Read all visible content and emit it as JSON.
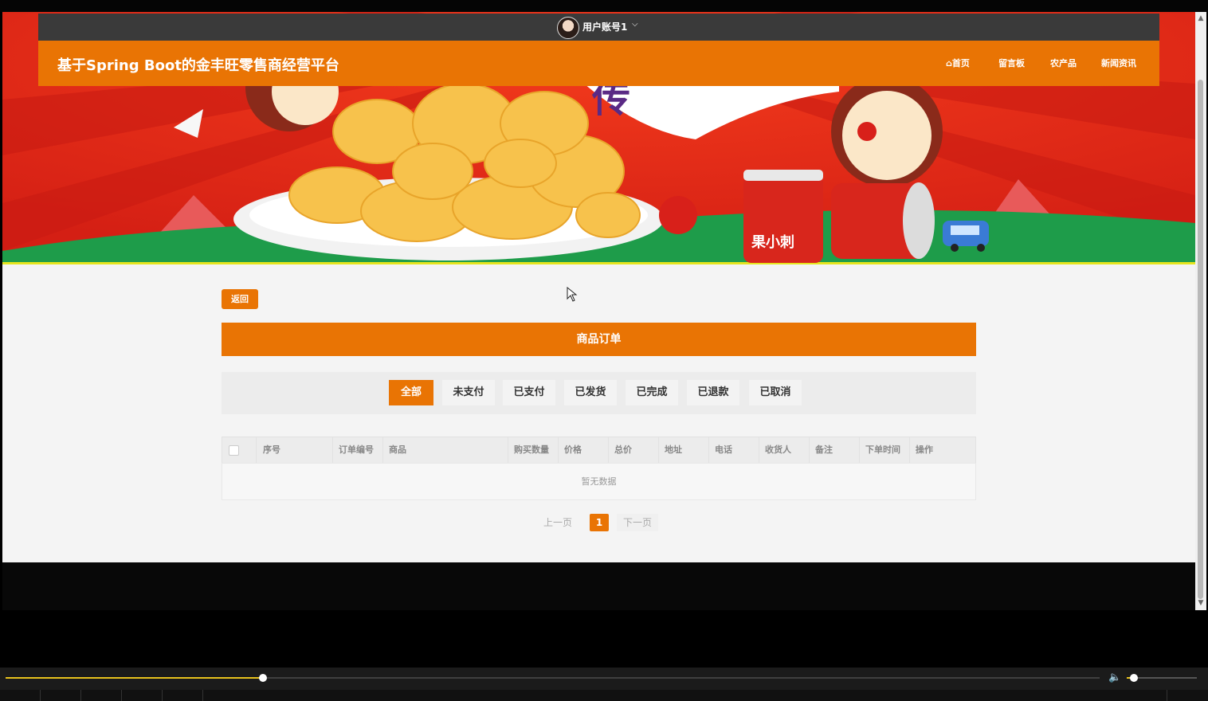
{
  "header": {
    "user_name": "用户账号1",
    "site_title": "基于Spring Boot的金丰旺零售商经营平台",
    "nav": [
      {
        "icon": "home-icon",
        "label": "首页"
      },
      {
        "label": "留言板"
      },
      {
        "label": "农产品"
      },
      {
        "label": "新闻资讯"
      }
    ]
  },
  "page": {
    "back_label": "返回",
    "title": "商品订单",
    "tabs": [
      "全部",
      "未支付",
      "已支付",
      "已发货",
      "已完成",
      "已退款",
      "已取消"
    ],
    "active_tab": "全部",
    "columns": [
      "序号",
      "订单编号",
      "商品",
      "购买数量",
      "价格",
      "总价",
      "地址",
      "电话",
      "收货人",
      "备注",
      "下单时间",
      "操作"
    ],
    "empty_text": "暂无数据",
    "pager": {
      "prev": "上一页",
      "current": "1",
      "next": "下一页"
    }
  },
  "colors": {
    "accent": "#e97404",
    "user_bar": "#3a3a3a"
  },
  "player": {
    "progress": 0.235,
    "volume": 0.1
  }
}
